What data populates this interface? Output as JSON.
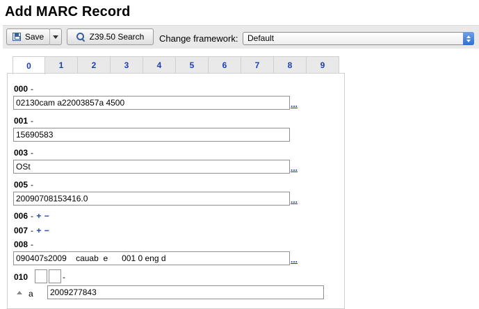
{
  "page": {
    "title": "Add MARC Record"
  },
  "toolbar": {
    "save_label": "Save",
    "z3950_label": "Z39.50 Search",
    "framework_label": "Change framework:",
    "framework_value": "Default"
  },
  "tabs": [
    "0",
    "1",
    "2",
    "3",
    "4",
    "5",
    "6",
    "7",
    "8",
    "9"
  ],
  "active_tab": "0",
  "fields": {
    "f000": {
      "tag": "000",
      "dash": "-",
      "value": "02130cam a22003857a 4500",
      "link": "..."
    },
    "f001": {
      "tag": "001",
      "dash": "-",
      "value": "15690583"
    },
    "f003": {
      "tag": "003",
      "dash": "-",
      "value": "OSt",
      "link": "..."
    },
    "f005": {
      "tag": "005",
      "dash": "-",
      "value": "20090708153416.0",
      "link": "..."
    },
    "f006": {
      "tag": "006",
      "dash": "-",
      "plus": "+",
      "minus": "−"
    },
    "f007": {
      "tag": "007",
      "dash": "-",
      "plus": "+",
      "minus": "−"
    },
    "f008": {
      "tag": "008",
      "dash": "-",
      "value": "090407s2009    cauab  e      001 0 eng d",
      "link": "..."
    },
    "f010": {
      "tag": "010",
      "dash": "-",
      "subfield_code": "a",
      "subfield_value": "2009277843"
    }
  },
  "icons": {
    "save": "floppy-disk-icon",
    "save_menu": "chevron-down-icon",
    "search": "magnifier-icon",
    "select": "updown-arrows-icon",
    "subfield": "triangle-up-icon"
  },
  "colors": {
    "link": "#1b3fb3",
    "toolbar_bg": "#e9e9e9",
    "select_accent": "#2f6fd3"
  }
}
